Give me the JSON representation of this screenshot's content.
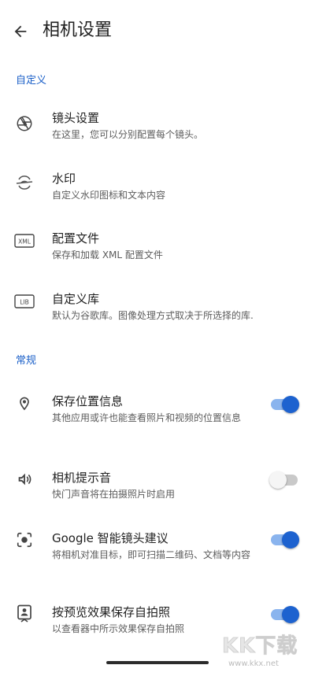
{
  "appbar": {
    "title": "相机设置"
  },
  "sections": {
    "custom": {
      "header": "自定义"
    },
    "general": {
      "header": "常规"
    }
  },
  "prefs": {
    "lens": {
      "title": "镜头设置",
      "summary": "在这里，您可以分别配置每个镜头。",
      "icon": "aperture-icon"
    },
    "watermark": {
      "title": "水印",
      "summary": "自定义水印图标和文本内容",
      "icon": "watermark-icon"
    },
    "config": {
      "title": "配置文件",
      "summary": "保存和加载 XML 配置文件",
      "icon": "xml-file-icon",
      "badge": "XML"
    },
    "library": {
      "title": "自定义库",
      "summary": "默认为谷歌库。图像处理方式取决于所选择的库.",
      "icon": "lib-icon",
      "badge": "LIB"
    },
    "location": {
      "title": "保存位置信息",
      "summary": "其他应用或许也能查看照片和视频的位置信息",
      "icon": "location-pin-icon",
      "enabled": true
    },
    "shutter_sound": {
      "title": "相机提示音",
      "summary": "快门声音将在拍摄照片时启用",
      "icon": "volume-icon",
      "enabled": false
    },
    "lens_suggestions": {
      "title": "Google 智能镜头建议",
      "summary": "将相机对准目标，即可扫描二维码、文档等内容",
      "icon": "lens-scan-icon",
      "enabled": true
    },
    "selfie_preview": {
      "title": "按预览效果保存自拍照",
      "summary": "以查看器中所示效果保存自拍照",
      "icon": "selfie-portrait-icon",
      "enabled": true
    }
  },
  "watermark_overlay": {
    "text": "KK下载",
    "url": "www.kkx.net"
  },
  "colors": {
    "accent": "#1d62cf",
    "section_header": "#1a5fc8",
    "switch_track_on": "#8ab4ee",
    "switch_track_off": "#c9c9c9"
  }
}
